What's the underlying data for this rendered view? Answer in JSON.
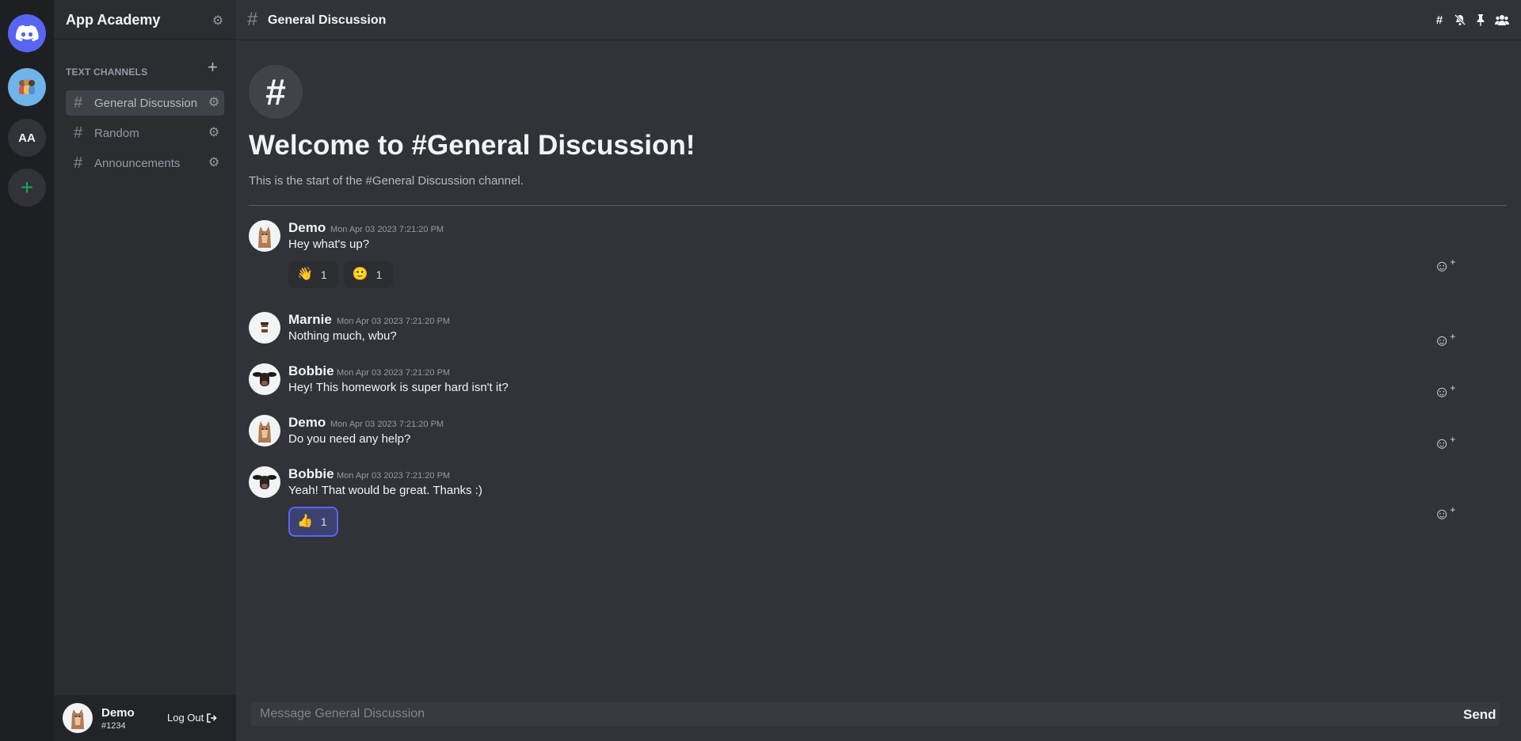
{
  "server": {
    "name": "App Academy",
    "aa_initials": "AA",
    "add_symbol": "+"
  },
  "sidebar": {
    "category_label": "TEXT CHANNELS",
    "channels": [
      {
        "label": "General Discussion",
        "active": true
      },
      {
        "label": "Random",
        "active": false
      },
      {
        "label": "Announcements",
        "active": false
      }
    ]
  },
  "user": {
    "name": "Demo",
    "tag": "#1234",
    "logout_label": "Log Out"
  },
  "channel": {
    "title": "General Discussion",
    "welcome_title": "Welcome to #General Discussion!",
    "welcome_subtitle": "This is the start of the #General Discussion channel.",
    "badge_symbol": "#"
  },
  "messages": [
    {
      "author": "Demo",
      "timestamp": "Mon Apr 03 2023 7:21:20 PM",
      "text": "Hey what's up?",
      "reactions": [
        {
          "emoji": "👋",
          "count": "1"
        },
        {
          "emoji": "🙂",
          "count": "1"
        }
      ]
    },
    {
      "author": "Marnie",
      "timestamp": "Mon Apr 03 2023 7:21:20 PM",
      "text": "Nothing much, wbu?",
      "reactions": []
    },
    {
      "author": "Bobbie",
      "timestamp": "Mon Apr 03 2023 7:21:20 PM",
      "text": "Hey! This homework is super hard isn't it?",
      "reactions": []
    },
    {
      "author": "Demo",
      "timestamp": "Mon Apr 03 2023 7:21:20 PM",
      "text": "Do you need any help?",
      "reactions": []
    },
    {
      "author": "Bobbie",
      "timestamp": "Mon Apr 03 2023 7:21:20 PM",
      "text": "Yeah! That would be great. Thanks :)",
      "reactions": [
        {
          "emoji": "👍",
          "count": "1"
        }
      ]
    }
  ],
  "composer": {
    "placeholder": "Message General Discussion",
    "send_label": "Send"
  },
  "colors": {
    "accent": "#5865f2",
    "add_green": "#23a55a"
  }
}
